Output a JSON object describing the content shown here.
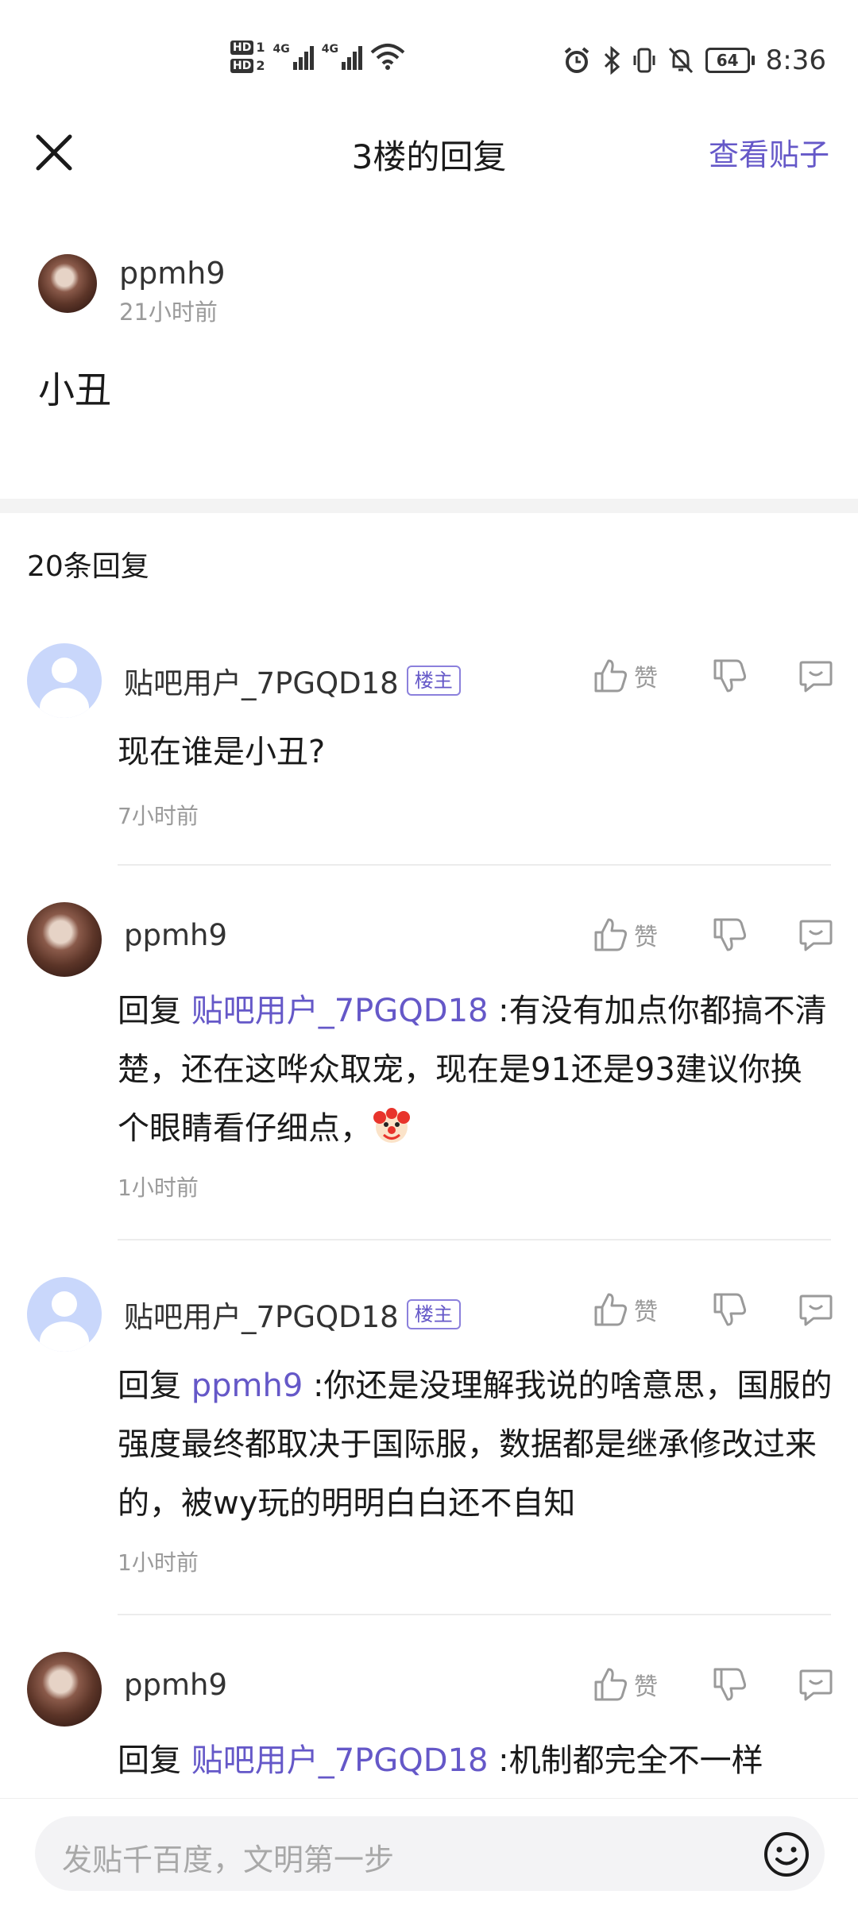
{
  "status_bar": {
    "hd1": "HD",
    "hd1_num": "1",
    "hd2": "HD",
    "hd2_num": "2",
    "net1": "4G",
    "net2": "4G",
    "battery": "64",
    "time": "8:36"
  },
  "header": {
    "title": "3楼的回复",
    "view_post": "查看贴子"
  },
  "original_post": {
    "author": "ppmh9",
    "time": "21小时前",
    "content": "小丑"
  },
  "reply_count": "20条回复",
  "like_label": "赞",
  "comments": [
    {
      "author": "贴吧用户_7PGQD18",
      "badge": "楼主",
      "prefix": "",
      "mention": "",
      "text": "现在谁是小丑?",
      "time": "7小时前"
    },
    {
      "author": "ppmh9",
      "badge": "",
      "prefix": "回复 ",
      "mention": "贴吧用户_7PGQD18",
      "text": " :有没有加点你都搞不清楚，还在这哗众取宠，现在是91还是93建议你换个眼睛看仔细点，",
      "emoji": "clown-face",
      "time": "1小时前"
    },
    {
      "author": "贴吧用户_7PGQD18",
      "badge": "楼主",
      "prefix": "回复 ",
      "mention": "ppmh9",
      "text": " :你还是没理解我说的啥意思，国服的强度最终都取决于国际服，数据都是继承修改过来的，被wy玩的明明白白还不自知",
      "time": "1小时前"
    },
    {
      "author": "ppmh9",
      "badge": "",
      "prefix": "回复 ",
      "mention": "贴吧用户_7PGQD18",
      "text": " :机制都完全不一样",
      "time": ""
    }
  ],
  "input": {
    "placeholder": "发贴千百度，文明第一步"
  },
  "colors": {
    "accent": "#6558c8",
    "muted": "#9a9a9a",
    "default_avatar": "#c9d7fb"
  }
}
